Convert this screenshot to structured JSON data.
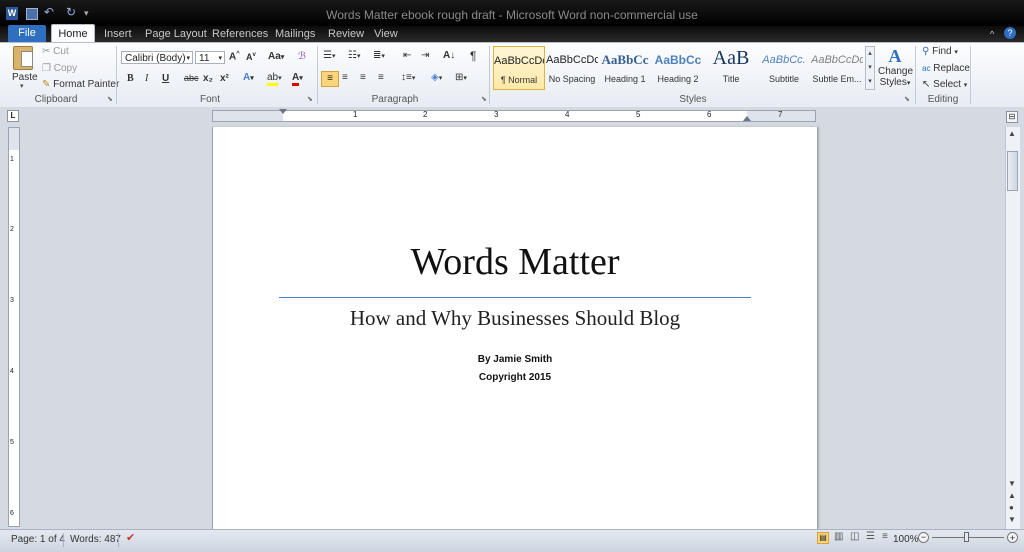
{
  "window": {
    "title": "Words Matter ebook rough draft - Microsoft Word non-commercial use"
  },
  "tabs": [
    "File",
    "Home",
    "Insert",
    "Page Layout",
    "References",
    "Mailings",
    "Review",
    "View"
  ],
  "clipboard": {
    "paste": "Paste",
    "cut": "Cut",
    "copy": "Copy",
    "format_painter": "Format Painter",
    "label": "Clipboard"
  },
  "font": {
    "name": "Calibri (Body)",
    "size": "11",
    "label": "Font",
    "aa": "Aa",
    "bold": "B",
    "italic": "I",
    "underline": "U",
    "strike": "abc",
    "sub": "x₂",
    "sup": "x²"
  },
  "paragraph": {
    "label": "Paragraph"
  },
  "styles": {
    "label": "Styles",
    "items": [
      {
        "preview": "AaBbCcDc",
        "name": "¶ Normal"
      },
      {
        "preview": "AaBbCcDc",
        "name": "No Spacing"
      },
      {
        "preview": "AaBbCc",
        "name": "Heading 1"
      },
      {
        "preview": "AaBbCc",
        "name": "Heading 2"
      },
      {
        "preview": "AaB",
        "name": "Title"
      },
      {
        "preview": "AaBbCc.",
        "name": "Subtitle"
      },
      {
        "preview": "AaBbCcDc",
        "name": "Subtle Em..."
      }
    ],
    "change_styles_1": "Change",
    "change_styles_2": "Styles"
  },
  "editing": {
    "label": "Editing",
    "find": "Find",
    "replace": "Replace",
    "select": "Select"
  },
  "ruler_numbers": [
    "1",
    "2",
    "3",
    "4",
    "5",
    "6",
    "7"
  ],
  "vruler_numbers": [
    "1",
    "2",
    "3",
    "4",
    "5",
    "6"
  ],
  "document": {
    "title": "Words Matter",
    "subtitle": "How and Why Businesses Should Blog",
    "author": "By Jamie Smith",
    "copyright": "Copyright 2015"
  },
  "status": {
    "page": "Page: 1 of 4",
    "words": "Words: 487",
    "zoom": "100%"
  },
  "colors": {
    "file_tab": "#2e6fbf",
    "title_rule": "#4f81bd",
    "heading_blue": "#365f91"
  }
}
